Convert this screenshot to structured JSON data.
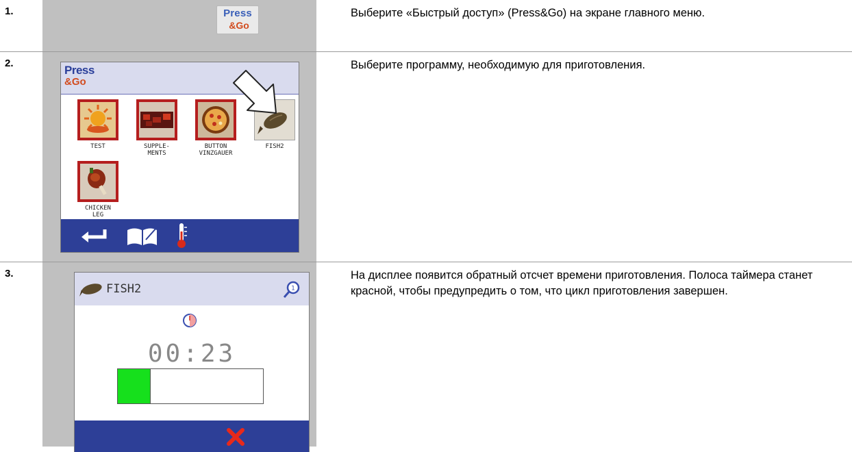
{
  "steps": [
    {
      "number": "1.",
      "logo": {
        "line1": "Press",
        "line2": "&Go"
      },
      "description": "Выберите «Быстрый доступ» (Press&Go) на экране главного меню."
    },
    {
      "number": "2.",
      "screen": {
        "header": {
          "line1": "Press",
          "line2": "&Go"
        },
        "programs": [
          {
            "label": "TEST",
            "icon": "sun-icon"
          },
          {
            "label": "SUPPLE-\nMENTS",
            "icon": "supplements-icon"
          },
          {
            "label": "BUTTON\nVINZGAUER",
            "icon": "pizza-icon"
          },
          {
            "label": "FISH2",
            "icon": "fish-icon"
          },
          {
            "label": "CHICKEN\nLEG",
            "icon": "chicken-leg-icon"
          }
        ],
        "footer_icons": [
          "back-arrow-icon",
          "book-icon",
          "thermometer-icon"
        ]
      },
      "description": "Выберите программу, необходимую для приготовления."
    },
    {
      "number": "3.",
      "screen": {
        "title": "FISH2",
        "timer": "00:23",
        "progress_fraction": 0.22,
        "colors": {
          "progress": "#16e01c",
          "cancel": "#e8291b",
          "footer": "#2d3f97"
        }
      },
      "description": "На дисплее появится обратный отсчет времени приготовления. Полоса таймера станет красной, чтобы предупредить о том, что цикл приготовления завершен."
    }
  ]
}
